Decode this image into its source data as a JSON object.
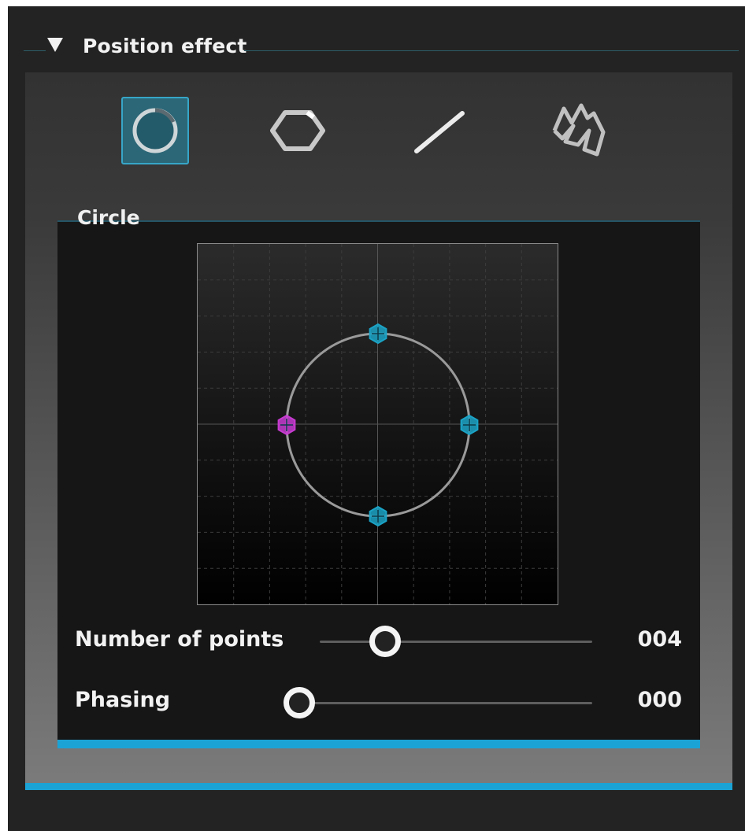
{
  "section": {
    "title": "Position effect",
    "expanded": true
  },
  "shape_buttons": [
    {
      "name": "circle",
      "icon": "circle-shape-icon",
      "active": true
    },
    {
      "name": "hexagon",
      "icon": "hexagon-shape-icon",
      "active": false
    },
    {
      "name": "line",
      "icon": "line-shape-icon",
      "active": false
    },
    {
      "name": "freeform",
      "icon": "freeform-shape-icon",
      "active": false
    }
  ],
  "subpanel": {
    "title": "Circle"
  },
  "plot": {
    "point_count": 4,
    "point_colors": {
      "first": "#c63bd0",
      "others": "#1ba3c6"
    },
    "curve_color": "#9a9a9a"
  },
  "controls": {
    "points": {
      "label": "Number of points",
      "value": "004",
      "fraction": 0.24
    },
    "phasing": {
      "label": "Phasing",
      "value": "000",
      "fraction": 0.0
    }
  },
  "colors": {
    "accent": "#1ba3d6",
    "background": "#232323"
  }
}
